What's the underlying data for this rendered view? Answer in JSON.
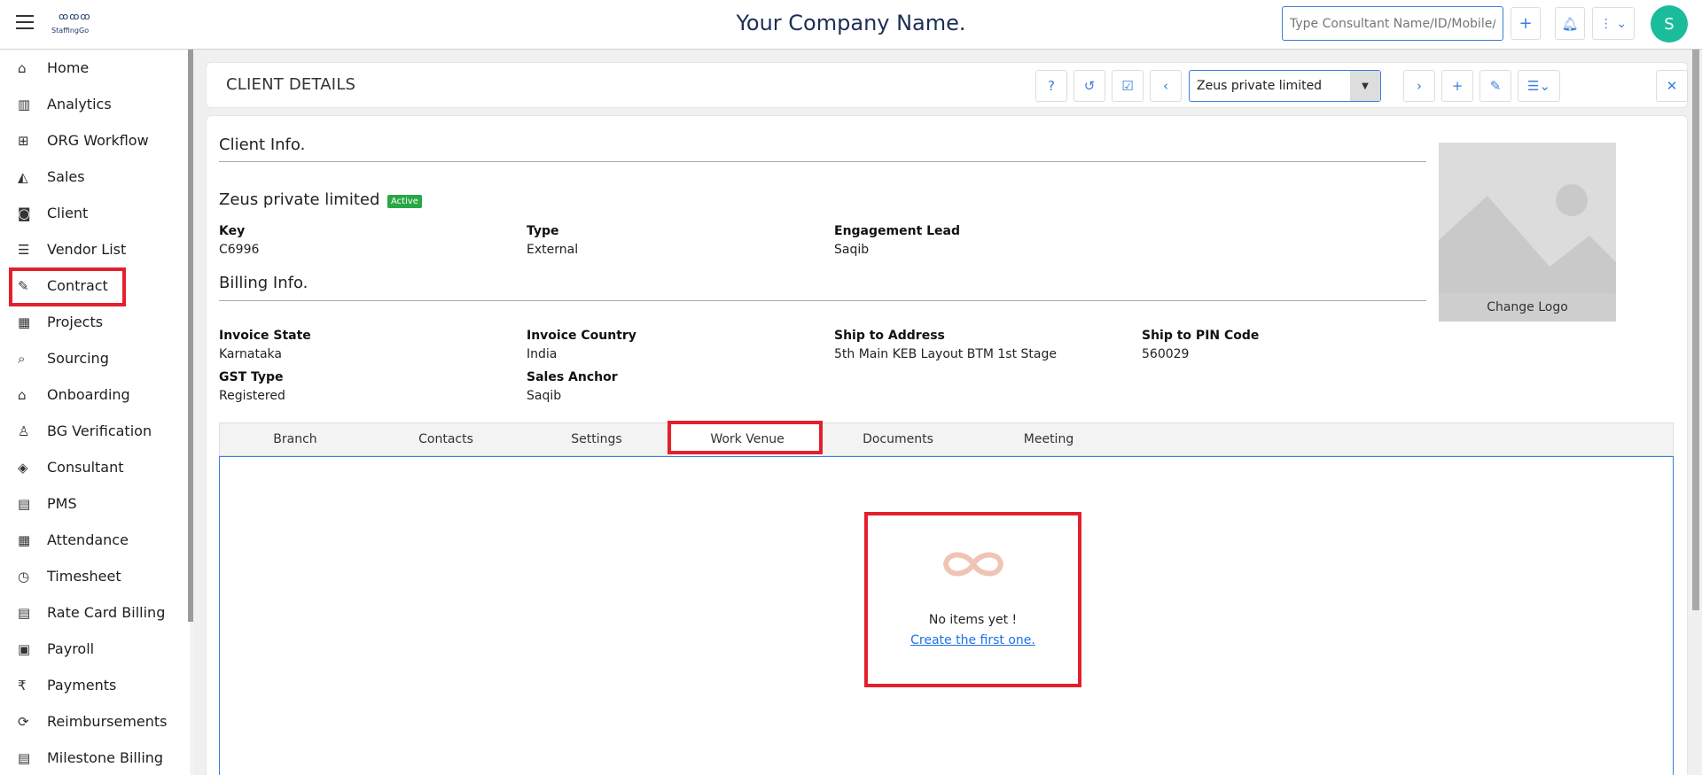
{
  "topbar": {
    "logo_text": "StaffingGo",
    "company_name": "Your Company Name.",
    "search_placeholder": "Type Consultant Name/ID/Mobile/...",
    "avatar_initial": "S"
  },
  "sidebar": {
    "items": [
      {
        "label": "Home",
        "icon": "home-icon"
      },
      {
        "label": "Analytics",
        "icon": "analytics-icon"
      },
      {
        "label": "ORG Workflow",
        "icon": "workflow-icon"
      },
      {
        "label": "Sales",
        "icon": "sales-icon"
      },
      {
        "label": "Client",
        "icon": "client-icon"
      },
      {
        "label": "Vendor List",
        "icon": "vendor-list-icon"
      },
      {
        "label": "Contract",
        "icon": "contract-icon"
      },
      {
        "label": "Projects",
        "icon": "projects-icon"
      },
      {
        "label": "Sourcing",
        "icon": "sourcing-icon"
      },
      {
        "label": "Onboarding",
        "icon": "onboarding-icon"
      },
      {
        "label": "BG Verification",
        "icon": "bg-verification-icon"
      },
      {
        "label": "Consultant",
        "icon": "consultant-icon"
      },
      {
        "label": "PMS",
        "icon": "pms-icon"
      },
      {
        "label": "Attendance",
        "icon": "attendance-icon"
      },
      {
        "label": "Timesheet",
        "icon": "timesheet-icon"
      },
      {
        "label": "Rate Card Billing",
        "icon": "rate-card-icon"
      },
      {
        "label": "Payroll",
        "icon": "payroll-icon"
      },
      {
        "label": "Payments",
        "icon": "rupee-icon"
      },
      {
        "label": "Reimbursements",
        "icon": "reimbursement-icon"
      },
      {
        "label": "Milestone Billing",
        "icon": "milestone-icon"
      }
    ]
  },
  "header": {
    "title": "CLIENT DETAILS",
    "selected_client": "Zeus private limited"
  },
  "client_info": {
    "section_title": "Client Info.",
    "name": "Zeus private limited",
    "status": "Active",
    "fields": [
      {
        "label": "Key",
        "value": "C6996"
      },
      {
        "label": "Type",
        "value": "External"
      },
      {
        "label": "Engagement Lead",
        "value": "Saqib"
      }
    ]
  },
  "billing_info": {
    "section_title": "Billing Info.",
    "fields": [
      {
        "label": "Invoice State",
        "value": "Karnataka"
      },
      {
        "label": "Invoice Country",
        "value": "India"
      },
      {
        "label": "Ship to Address",
        "value": "5th Main KEB Layout BTM 1st Stage"
      },
      {
        "label": "Ship to PIN Code",
        "value": "560029"
      },
      {
        "label": "GST Type",
        "value": "Registered"
      },
      {
        "label": "Sales Anchor",
        "value": "Saqib"
      }
    ]
  },
  "logo_panel": {
    "change_label": "Change Logo"
  },
  "tabs": [
    {
      "label": "Branch"
    },
    {
      "label": "Contacts"
    },
    {
      "label": "Settings"
    },
    {
      "label": "Work Venue",
      "active": true
    },
    {
      "label": "Documents"
    },
    {
      "label": "Meeting"
    }
  ],
  "empty_state": {
    "message": "No items yet !",
    "link": "Create the first one."
  },
  "colors": {
    "accent": "#3b7ddd",
    "highlight": "#e3202d",
    "active_badge": "#28a745",
    "avatar": "#1abc9c"
  }
}
